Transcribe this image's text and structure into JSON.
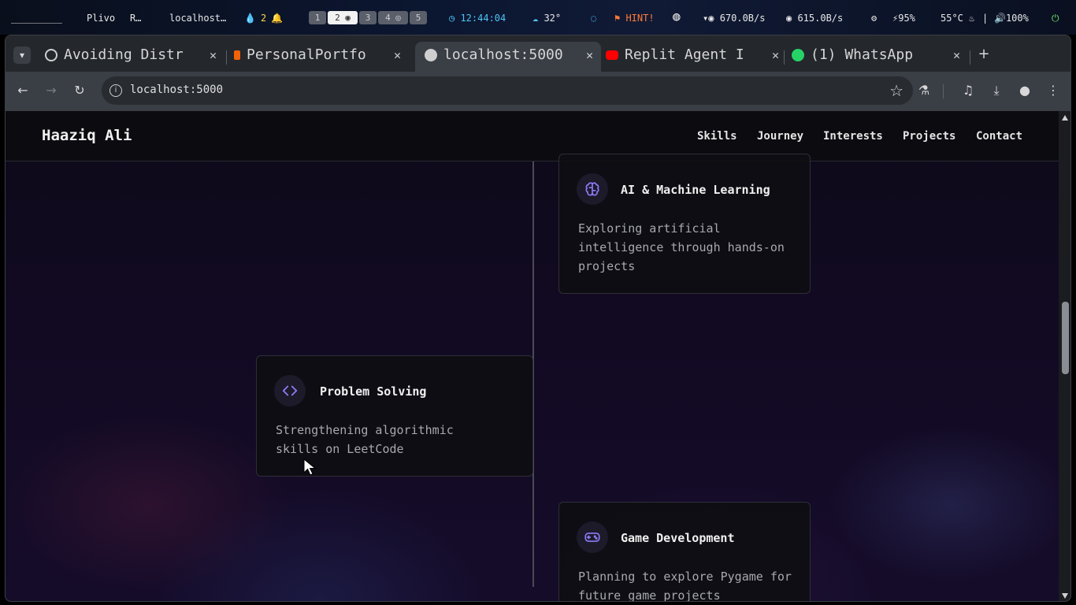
{
  "system_bar": {
    "workspace_label": "_________",
    "window_title_1": "Plivo",
    "window_title_2": "R…",
    "focused_window": "localhost…",
    "notif_count": "2",
    "workspaces": [
      "1",
      "2",
      "3",
      "4",
      "5"
    ],
    "clock": "12:44:04",
    "weather": "32°",
    "hint": "HINT!",
    "net_down": "670.0B/s",
    "net_up": "615.0B/s",
    "battery": "95%",
    "temp": "55°C",
    "separator": "|",
    "volume": "100%"
  },
  "browser": {
    "tabs": [
      {
        "title": "Avoiding Distr",
        "favicon_color": "#d0d0d0",
        "active": false
      },
      {
        "title": "PersonalPortfo",
        "favicon_color": "#f26207",
        "active": false
      },
      {
        "title": "localhost:5000",
        "favicon_color": "#cfcfcf",
        "active": true
      },
      {
        "title": "Replit Agent I",
        "favicon_color": "#ff0000",
        "active": false
      },
      {
        "title": "(1) WhatsApp",
        "favicon_color": "#25d366",
        "active": false
      }
    ],
    "new_tab": "+",
    "url": "localhost:5000"
  },
  "site": {
    "brand": "Haaziq Ali",
    "nav": [
      "Skills",
      "Journey",
      "Interests",
      "Projects",
      "Contact"
    ],
    "cards": [
      {
        "title": "AI & Machine Learning",
        "description": "Exploring artificial intelligence through hands-on projects",
        "icon": "brain-icon",
        "side": "right"
      },
      {
        "title": "Problem Solving",
        "description": "Strengthening algorithmic skills on LeetCode",
        "icon": "code-icon",
        "side": "left"
      },
      {
        "title": "Game Development",
        "description": "Planning to explore Pygame for future game projects",
        "icon": "gamepad-icon",
        "side": "right"
      }
    ]
  },
  "colors": {
    "accent_purple": "#8b7cf6",
    "background": "#120a22"
  }
}
